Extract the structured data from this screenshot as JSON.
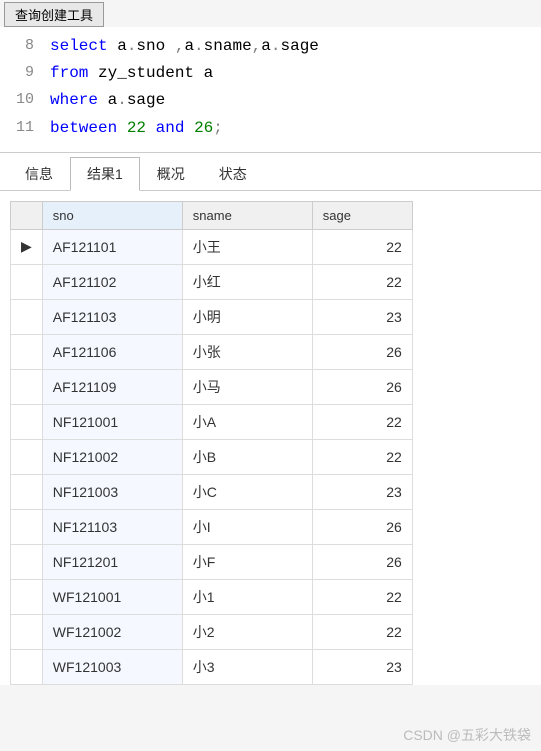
{
  "topTab": "查询创建工具",
  "editor": {
    "lines": [
      {
        "num": "8",
        "tokens": [
          {
            "t": "select",
            "c": "kw"
          },
          {
            "t": " a",
            "c": "ident"
          },
          {
            "t": ".",
            "c": "punct"
          },
          {
            "t": "sno ",
            "c": "ident"
          },
          {
            "t": ",",
            "c": "punct"
          },
          {
            "t": "a",
            "c": "ident"
          },
          {
            "t": ".",
            "c": "punct"
          },
          {
            "t": "sname",
            "c": "ident"
          },
          {
            "t": ",",
            "c": "punct"
          },
          {
            "t": "a",
            "c": "ident"
          },
          {
            "t": ".",
            "c": "punct"
          },
          {
            "t": "sage",
            "c": "ident"
          }
        ]
      },
      {
        "num": "9",
        "tokens": [
          {
            "t": "from",
            "c": "kw"
          },
          {
            "t": " zy_student a",
            "c": "ident"
          }
        ]
      },
      {
        "num": "10",
        "tokens": [
          {
            "t": "where",
            "c": "kw"
          },
          {
            "t": " a",
            "c": "ident"
          },
          {
            "t": ".",
            "c": "punct"
          },
          {
            "t": "sage",
            "c": "ident"
          }
        ]
      },
      {
        "num": "11",
        "tokens": [
          {
            "t": "between",
            "c": "kw"
          },
          {
            "t": " ",
            "c": "ident"
          },
          {
            "t": "22",
            "c": "num"
          },
          {
            "t": " ",
            "c": "ident"
          },
          {
            "t": "and",
            "c": "kw"
          },
          {
            "t": " ",
            "c": "ident"
          },
          {
            "t": "26",
            "c": "num"
          },
          {
            "t": ";",
            "c": "punct"
          }
        ]
      }
    ]
  },
  "tabs": [
    {
      "label": "信息",
      "active": false
    },
    {
      "label": "结果1",
      "active": true
    },
    {
      "label": "概况",
      "active": false
    },
    {
      "label": "状态",
      "active": false
    }
  ],
  "grid": {
    "headers": {
      "sno": "sno",
      "sname": "sname",
      "sage": "sage"
    },
    "rows": [
      {
        "sno": "AF121101",
        "sname": "小王",
        "sage": "22",
        "current": true
      },
      {
        "sno": "AF121102",
        "sname": "小红",
        "sage": "22"
      },
      {
        "sno": "AF121103",
        "sname": "小明",
        "sage": "23"
      },
      {
        "sno": "AF121106",
        "sname": "小张",
        "sage": "26"
      },
      {
        "sno": "AF121109",
        "sname": "小马",
        "sage": "26"
      },
      {
        "sno": "NF121001",
        "sname": "小A",
        "sage": "22"
      },
      {
        "sno": "NF121002",
        "sname": "小B",
        "sage": "22"
      },
      {
        "sno": "NF121003",
        "sname": "小C",
        "sage": "23"
      },
      {
        "sno": "NF121103",
        "sname": "小I",
        "sage": "26"
      },
      {
        "sno": "NF121201",
        "sname": "小F",
        "sage": "26"
      },
      {
        "sno": "WF121001",
        "sname": "小1",
        "sage": "22"
      },
      {
        "sno": "WF121002",
        "sname": "小2",
        "sage": "22"
      },
      {
        "sno": "WF121003",
        "sname": "小3",
        "sage": "23"
      }
    ]
  },
  "watermark": "CSDN @五彩大铁袋"
}
